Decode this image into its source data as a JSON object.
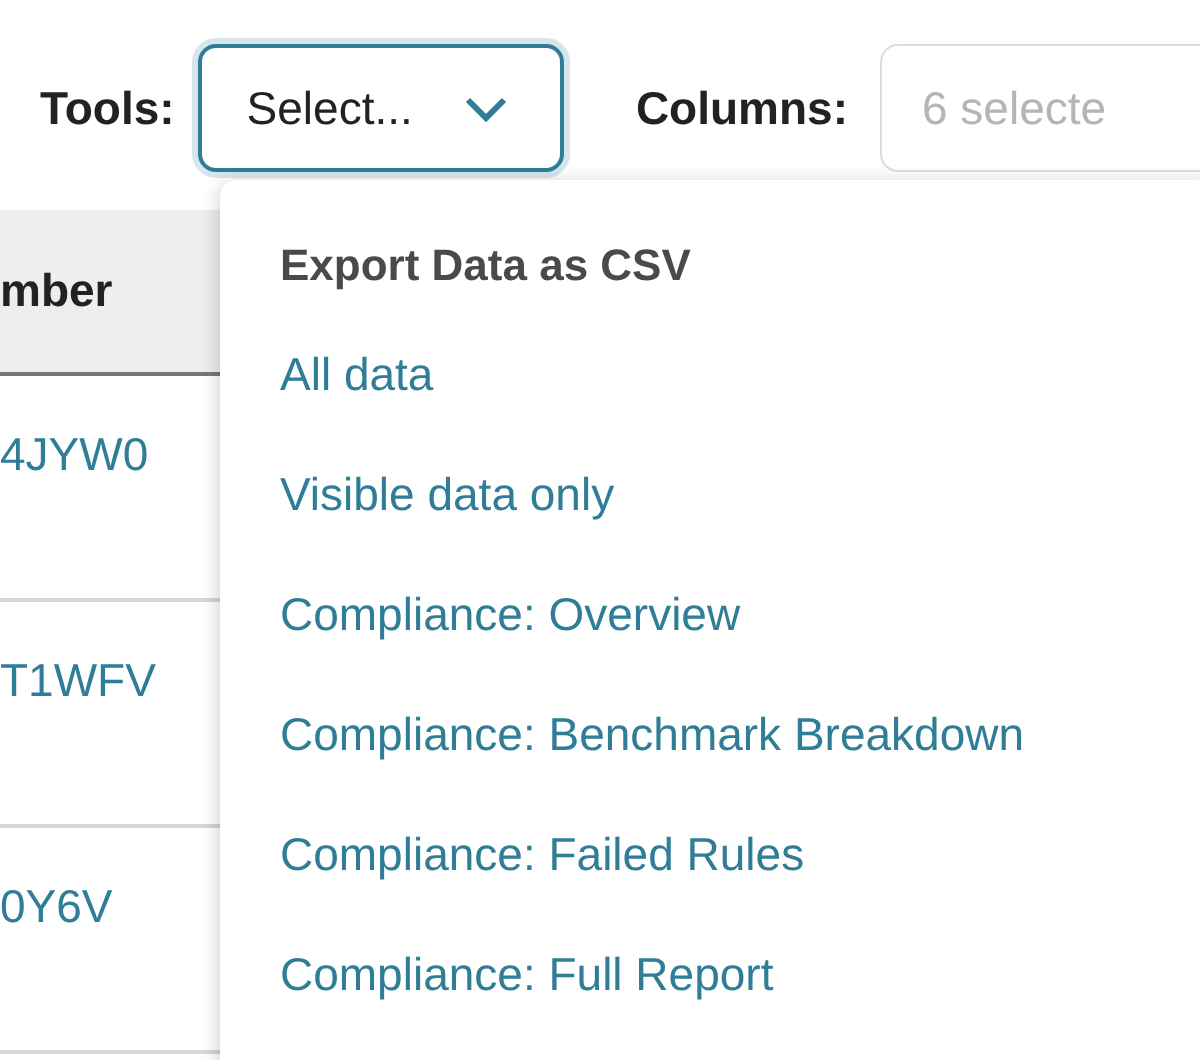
{
  "toolbar": {
    "tools_label": "Tools:",
    "tools_select": {
      "value": "Select...",
      "expanded": true
    },
    "columns_label": "Columns:",
    "columns_field": {
      "placeholder": "6 selecte"
    }
  },
  "table": {
    "columns": [
      "mber"
    ],
    "rows": [
      {
        "cells": [
          "4JYW0"
        ]
      },
      {
        "cells": [
          "T1WFV"
        ]
      },
      {
        "cells": [
          "0Y6V"
        ]
      }
    ]
  },
  "dropdown": {
    "heading": "Export Data as CSV",
    "items": [
      {
        "label": "All data"
      },
      {
        "label": "Visible data only"
      },
      {
        "label": "Compliance: Overview"
      },
      {
        "label": "Compliance: Benchmark Breakdown"
      },
      {
        "label": "Compliance: Failed Rules"
      },
      {
        "label": "Compliance: Full Report"
      }
    ]
  }
}
